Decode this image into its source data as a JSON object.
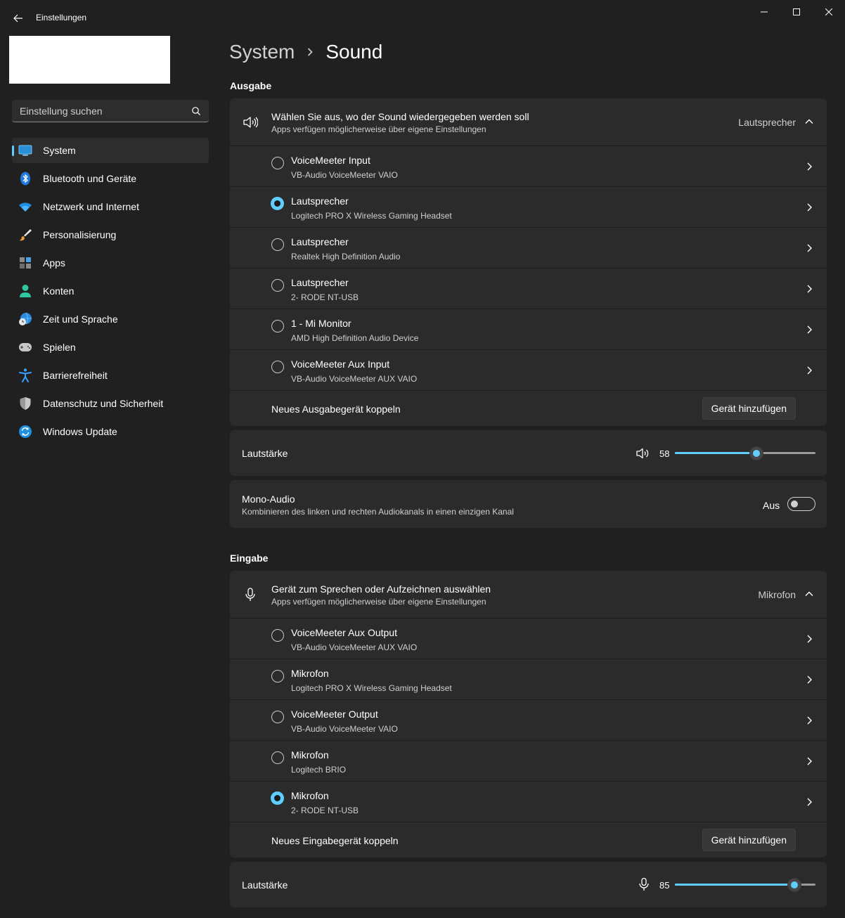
{
  "window": {
    "title": "Einstellungen"
  },
  "search": {
    "placeholder": "Einstellung suchen"
  },
  "sidebar": {
    "items": [
      {
        "label": "System",
        "icon": "monitor-icon",
        "active": true
      },
      {
        "label": "Bluetooth und Geräte",
        "icon": "bluetooth-icon"
      },
      {
        "label": "Netzwerk und Internet",
        "icon": "wifi-icon"
      },
      {
        "label": "Personalisierung",
        "icon": "brush-icon"
      },
      {
        "label": "Apps",
        "icon": "apps-icon"
      },
      {
        "label": "Konten",
        "icon": "person-icon"
      },
      {
        "label": "Zeit und Sprache",
        "icon": "globe-clock-icon"
      },
      {
        "label": "Spielen",
        "icon": "gamepad-icon"
      },
      {
        "label": "Barrierefreiheit",
        "icon": "accessibility-icon"
      },
      {
        "label": "Datenschutz und Sicherheit",
        "icon": "shield-icon"
      },
      {
        "label": "Windows Update",
        "icon": "update-icon"
      }
    ]
  },
  "breadcrumb": {
    "parent": "System",
    "current": "Sound"
  },
  "output": {
    "section_title": "Ausgabe",
    "header": {
      "title": "Wählen Sie aus, wo der Sound wiedergegeben werden soll",
      "subtitle": "Apps verfügen möglicherweise über eigene Einstellungen",
      "value": "Lautsprecher"
    },
    "devices": [
      {
        "name": "VoiceMeeter Input",
        "sub": "VB-Audio VoiceMeeter VAIO",
        "selected": false
      },
      {
        "name": "Lautsprecher",
        "sub": "Logitech PRO X Wireless Gaming Headset",
        "selected": true
      },
      {
        "name": "Lautsprecher",
        "sub": "Realtek High Definition Audio",
        "selected": false
      },
      {
        "name": "Lautsprecher",
        "sub": "2- RODE NT-USB",
        "selected": false
      },
      {
        "name": "1 - Mi Monitor",
        "sub": "AMD High Definition Audio Device",
        "selected": false
      },
      {
        "name": "VoiceMeeter Aux Input",
        "sub": "VB-Audio VoiceMeeter AUX VAIO",
        "selected": false
      }
    ],
    "pair": {
      "label": "Neues Ausgabegerät koppeln",
      "button": "Gerät hinzufügen"
    },
    "volume": {
      "label": "Lautstärke",
      "value": "58",
      "level": 58
    },
    "mono": {
      "label": "Mono-Audio",
      "subtitle": "Kombinieren des linken und rechten Audiokanals in einen einzigen Kanal",
      "state": "Aus"
    }
  },
  "input": {
    "section_title": "Eingabe",
    "header": {
      "title": "Gerät zum Sprechen oder Aufzeichnen auswählen",
      "subtitle": "Apps verfügen möglicherweise über eigene Einstellungen",
      "value": "Mikrofon"
    },
    "devices": [
      {
        "name": "VoiceMeeter Aux Output",
        "sub": "VB-Audio VoiceMeeter AUX VAIO",
        "selected": false
      },
      {
        "name": "Mikrofon",
        "sub": "Logitech PRO X Wireless Gaming Headset",
        "selected": false
      },
      {
        "name": "VoiceMeeter Output",
        "sub": "VB-Audio VoiceMeeter VAIO",
        "selected": false
      },
      {
        "name": "Mikrofon",
        "sub": "Logitech BRIO",
        "selected": false
      },
      {
        "name": "Mikrofon",
        "sub": "2- RODE NT-USB",
        "selected": true
      }
    ],
    "pair": {
      "label": "Neues Eingabegerät koppeln",
      "button": "Gerät hinzufügen"
    },
    "volume": {
      "label": "Lautstärke",
      "value": "85",
      "level": 85
    }
  },
  "colors": {
    "accent": "#60cdff",
    "background": "#202020",
    "card": "#2b2b2b"
  }
}
